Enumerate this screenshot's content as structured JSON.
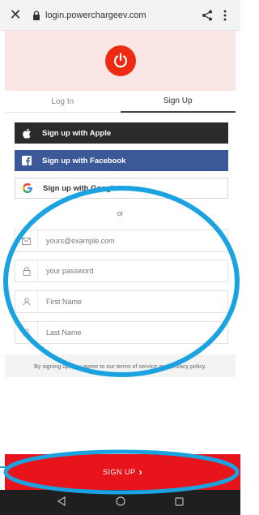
{
  "browser": {
    "close_icon": "close-icon",
    "url": "login.powerchargeev.com"
  },
  "brand": {
    "logo_icon": "power-icon",
    "logo_color": "#ed2b12"
  },
  "tabs": [
    {
      "label": "Log In",
      "active": false
    },
    {
      "label": "Sign Up",
      "active": true
    }
  ],
  "social": {
    "apple": "Sign up with Apple",
    "facebook": "Sign up with Facebook",
    "google": "Sign up with Google"
  },
  "or_text": "or",
  "fields": {
    "email_placeholder": "yours@example.com",
    "password_placeholder": "your password",
    "first_name_placeholder": "First Name",
    "last_name_placeholder": "Last Name"
  },
  "terms": "By signing up, you agree to our terms of service and privacy policy.",
  "signup_button": "SIGN UP",
  "signup_chevron": "›",
  "colors": {
    "accent_red": "#e8141c",
    "annotation_blue": "#1aa3e0",
    "facebook_blue": "#3b5998"
  }
}
